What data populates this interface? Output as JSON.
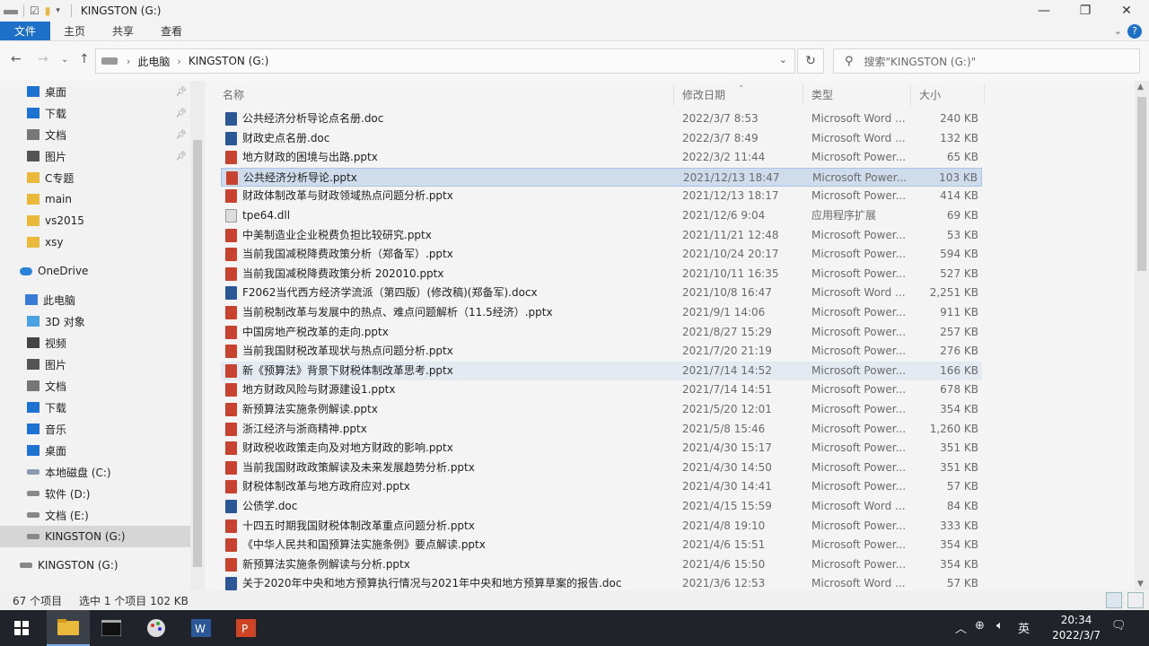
{
  "title": "KINGSTON (G:)",
  "ribbon": {
    "file": "文件",
    "home": "主页",
    "share": "共享",
    "view": "查看"
  },
  "breadcrumb": [
    "此电脑",
    "KINGSTON (G:)"
  ],
  "search_placeholder": "搜索\"KINGSTON (G:)\"",
  "sidebar": [
    {
      "label": "桌面",
      "icon": "desktop-icon",
      "color": "#1e73d0",
      "pinned": true
    },
    {
      "label": "下载",
      "icon": "download-icon",
      "color": "#1e73d0",
      "pinned": true
    },
    {
      "label": "文档",
      "icon": "document-icon",
      "color": "#777",
      "pinned": true
    },
    {
      "label": "图片",
      "icon": "picture-icon",
      "color": "#555",
      "pinned": true
    },
    {
      "label": "C专题",
      "icon": "folder-icon",
      "color": "#e8b93a",
      "pinned": false
    },
    {
      "label": "main",
      "icon": "folder-icon",
      "color": "#e8b93a",
      "pinned": false
    },
    {
      "label": "vs2015",
      "icon": "folder-icon",
      "color": "#e8b93a",
      "pinned": false
    },
    {
      "label": "xsy",
      "icon": "folder-icon",
      "color": "#e8b93a",
      "pinned": false
    },
    {
      "label": "OneDrive",
      "icon": "cloud-icon",
      "color": "#2b83d9",
      "pinned": false
    },
    {
      "label": "此电脑",
      "icon": "computer-icon",
      "color": "#3a7bd5",
      "pinned": false
    },
    {
      "label": "3D 对象",
      "icon": "cube-icon",
      "color": "#4aa3e0",
      "pinned": false
    },
    {
      "label": "视频",
      "icon": "video-icon",
      "color": "#444",
      "pinned": false
    },
    {
      "label": "图片",
      "icon": "picture-icon",
      "color": "#555",
      "pinned": false
    },
    {
      "label": "文档",
      "icon": "document-icon",
      "color": "#777",
      "pinned": false
    },
    {
      "label": "下载",
      "icon": "download-icon",
      "color": "#1e73d0",
      "pinned": false
    },
    {
      "label": "音乐",
      "icon": "music-icon",
      "color": "#1e73d0",
      "pinned": false
    },
    {
      "label": "桌面",
      "icon": "desktop-icon",
      "color": "#1e73d0",
      "pinned": false
    },
    {
      "label": "本地磁盘 (C:)",
      "icon": "drive-icon",
      "color": "#8a9ab0",
      "pinned": false
    },
    {
      "label": "软件 (D:)",
      "icon": "drive-icon",
      "color": "#888",
      "pinned": false
    },
    {
      "label": "文档 (E:)",
      "icon": "drive-icon",
      "color": "#888",
      "pinned": false
    },
    {
      "label": "KINGSTON (G:)",
      "icon": "usb-drive-icon",
      "color": "#888",
      "pinned": false
    },
    {
      "label": "KINGSTON (G:)",
      "icon": "usb-drive-icon",
      "color": "#888",
      "pinned": false
    }
  ],
  "columns": {
    "name": "名称",
    "date": "修改日期",
    "type": "类型",
    "size": "大小"
  },
  "files": [
    {
      "name": "公共经济分析导论点名册.doc",
      "date": "2022/3/7 8:53",
      "type": "Microsoft Word ...",
      "size": "240 KB",
      "kind": "doc"
    },
    {
      "name": "财政史点名册.doc",
      "date": "2022/3/7 8:49",
      "type": "Microsoft Word ...",
      "size": "132 KB",
      "kind": "doc"
    },
    {
      "name": "地方财政的困境与出路.pptx",
      "date": "2022/3/2 11:44",
      "type": "Microsoft Power...",
      "size": "65 KB",
      "kind": "pptx"
    },
    {
      "name": "公共经济分析导论.pptx",
      "date": "2021/12/13 18:47",
      "type": "Microsoft Power...",
      "size": "103 KB",
      "kind": "pptx"
    },
    {
      "name": "财政体制改革与财政领域热点问题分析.pptx",
      "date": "2021/12/13 18:17",
      "type": "Microsoft Power...",
      "size": "414 KB",
      "kind": "pptx"
    },
    {
      "name": "tpe64.dll",
      "date": "2021/12/6 9:04",
      "type": "应用程序扩展",
      "size": "69 KB",
      "kind": "dll"
    },
    {
      "name": "中美制造业企业税费负担比较研究.pptx",
      "date": "2021/11/21 12:48",
      "type": "Microsoft Power...",
      "size": "53 KB",
      "kind": "pptx"
    },
    {
      "name": "当前我国减税降费政策分析（郑备军）.pptx",
      "date": "2021/10/24 20:17",
      "type": "Microsoft Power...",
      "size": "594 KB",
      "kind": "pptx"
    },
    {
      "name": "当前我国减税降费政策分析 202010.pptx",
      "date": "2021/10/11 16:35",
      "type": "Microsoft Power...",
      "size": "527 KB",
      "kind": "pptx"
    },
    {
      "name": "F2062当代西方经济学流派（第四版）(修改稿)(郑备军).docx",
      "date": "2021/10/8 16:47",
      "type": "Microsoft Word ...",
      "size": "2,251 KB",
      "kind": "doc"
    },
    {
      "name": "当前税制改革与发展中的热点、难点问题解析（11.5经济）.pptx",
      "date": "2021/9/1 14:06",
      "type": "Microsoft Power...",
      "size": "911 KB",
      "kind": "pptx"
    },
    {
      "name": "中国房地产税改革的走向.pptx",
      "date": "2021/8/27 15:29",
      "type": "Microsoft Power...",
      "size": "257 KB",
      "kind": "pptx"
    },
    {
      "name": "当前我国财税改革现状与热点问题分析.pptx",
      "date": "2021/7/20 21:19",
      "type": "Microsoft Power...",
      "size": "276 KB",
      "kind": "pptx"
    },
    {
      "name": "新《预算法》背景下财税体制改革思考.pptx",
      "date": "2021/7/14 14:52",
      "type": "Microsoft Power...",
      "size": "166 KB",
      "kind": "pptx"
    },
    {
      "name": "地方财政风险与财源建设1.pptx",
      "date": "2021/7/14 14:51",
      "type": "Microsoft Power...",
      "size": "678 KB",
      "kind": "pptx"
    },
    {
      "name": "新预算法实施条例解读.pptx",
      "date": "2021/5/20 12:01",
      "type": "Microsoft Power...",
      "size": "354 KB",
      "kind": "pptx"
    },
    {
      "name": "浙江经济与浙商精神.pptx",
      "date": "2021/5/8 15:46",
      "type": "Microsoft Power...",
      "size": "1,260 KB",
      "kind": "pptx"
    },
    {
      "name": "财政税收政策走向及对地方财政的影响.pptx",
      "date": "2021/4/30 15:17",
      "type": "Microsoft Power...",
      "size": "351 KB",
      "kind": "pptx"
    },
    {
      "name": "当前我国财政政策解读及未来发展趋势分析.pptx",
      "date": "2021/4/30 14:50",
      "type": "Microsoft Power...",
      "size": "351 KB",
      "kind": "pptx"
    },
    {
      "name": "财税体制改革与地方政府应对.pptx",
      "date": "2021/4/30 14:41",
      "type": "Microsoft Power...",
      "size": "57 KB",
      "kind": "pptx"
    },
    {
      "name": "公债学.doc",
      "date": "2021/4/15 15:59",
      "type": "Microsoft Word ...",
      "size": "84 KB",
      "kind": "doc"
    },
    {
      "name": "十四五时期我国财税体制改革重点问题分析.pptx",
      "date": "2021/4/8 19:10",
      "type": "Microsoft Power...",
      "size": "333 KB",
      "kind": "pptx"
    },
    {
      "name": "《中华人民共和国预算法实施条例》要点解读.pptx",
      "date": "2021/4/6 15:51",
      "type": "Microsoft Power...",
      "size": "354 KB",
      "kind": "pptx"
    },
    {
      "name": "新预算法实施条例解读与分析.pptx",
      "date": "2021/4/6 15:50",
      "type": "Microsoft Power...",
      "size": "354 KB",
      "kind": "pptx"
    },
    {
      "name": "关于2020年中央和地方预算执行情况与2021年中央和地方预算草案的报告.doc",
      "date": "2021/3/6 12:53",
      "type": "Microsoft Word ...",
      "size": "57 KB",
      "kind": "doc"
    }
  ],
  "selected_index": 3,
  "hovered_index": 13,
  "status": {
    "count": "67 个项目",
    "selection": "选中 1 个项目  102 KB"
  },
  "taskbar": {
    "time": "20:34",
    "date": "2022/3/7",
    "ime": "英"
  }
}
